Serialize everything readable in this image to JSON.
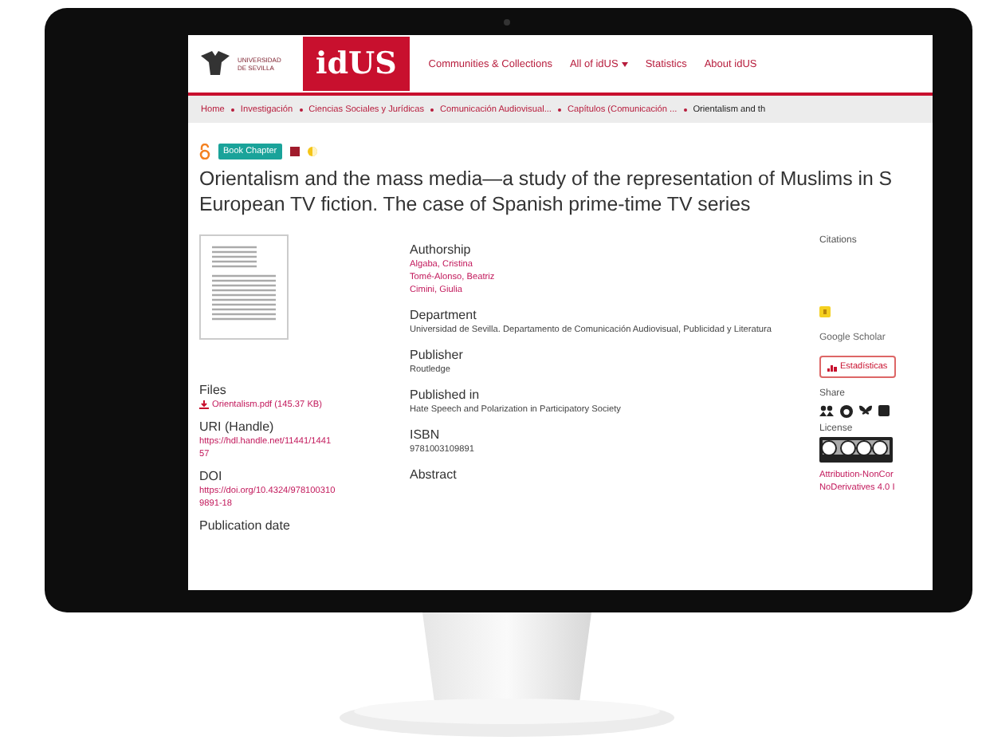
{
  "header": {
    "logo_lines": [
      "UNIVERSIDAD",
      "DE SEVILLA"
    ],
    "brand": "idUS",
    "nav": [
      {
        "label": "Communities & Collections",
        "dropdown": false
      },
      {
        "label": "All of idUS",
        "dropdown": true
      },
      {
        "label": "Statistics",
        "dropdown": false
      },
      {
        "label": "About idUS",
        "dropdown": false
      }
    ]
  },
  "breadcrumb": [
    {
      "label": "Home",
      "current": false
    },
    {
      "label": "Investigación",
      "current": false
    },
    {
      "label": "Ciencias Sociales y Jurídicas",
      "current": false
    },
    {
      "label": "Comunicación Audiovisual...",
      "current": false
    },
    {
      "label": "Capítulos (Comunicación ...",
      "current": false
    },
    {
      "label": "Orientalism and th",
      "current": true
    }
  ],
  "badges": {
    "type": "Book Chapter"
  },
  "title_lines": [
    "Orientalism and the mass media—a study of the representation of Muslims in S",
    "European TV fiction. The case of Spanish prime-time TV series"
  ],
  "left": {
    "files": {
      "label": "Files",
      "file": "Orientalism.pdf (145.37 KB)"
    },
    "uri": {
      "label": "URI (Handle)",
      "lines": [
        "https://hdl.handle.net/11441/1441",
        "57"
      ]
    },
    "doi": {
      "label": "DOI",
      "lines": [
        "https://doi.org/10.4324/978100310",
        "9891-18"
      ]
    },
    "publication_date": {
      "label": "Publication date"
    }
  },
  "sections": [
    {
      "label": "Authorship",
      "values": [
        {
          "text": "Algaba, Cristina",
          "link": true
        },
        {
          "text": "Tomé-Alonso, Beatriz",
          "link": true
        },
        {
          "text": "Cimini, Giulia",
          "link": true
        }
      ]
    },
    {
      "label": "Department",
      "values": [
        {
          "text": "Universidad de Sevilla. Departamento de Comunicación Audiovisual, Publicidad y Literatura",
          "link": false
        }
      ]
    },
    {
      "label": "Publisher",
      "values": [
        {
          "text": "Routledge",
          "link": false
        }
      ]
    },
    {
      "label": "Published in",
      "values": [
        {
          "text": "Hate Speech and Polarization in Participatory Society",
          "link": false
        }
      ]
    },
    {
      "label": "ISBN",
      "values": [
        {
          "text": "9781003109891",
          "link": false
        }
      ]
    },
    {
      "label": "Abstract"
    }
  ],
  "right": {
    "citations": "Citations",
    "scholar": "Google Scholar",
    "stats_button": "Estadísticas",
    "share": "Share",
    "license": "License",
    "license_lines": [
      "Attribution-NonCor",
      "NoDerivatives 4.0 I"
    ]
  }
}
